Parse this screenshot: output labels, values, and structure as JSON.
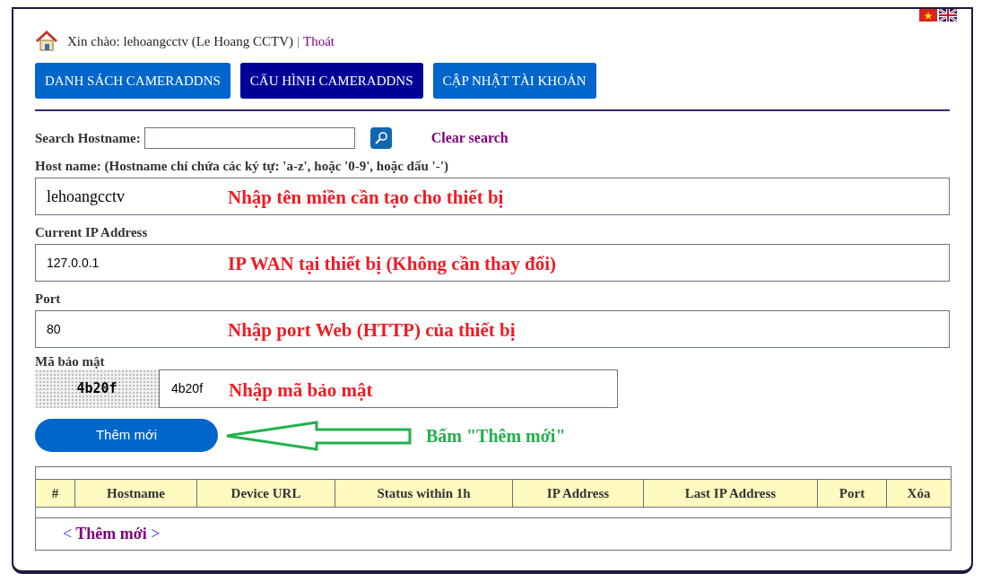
{
  "greeting": {
    "text": "Xin chào: lehoangcctv (Le Hoang CCTV)",
    "separator": "|",
    "logout": "Thoát"
  },
  "tabs": [
    {
      "label": "DANH SÁCH CAMERADDNS",
      "selected": false
    },
    {
      "label": "CẤU HÌNH CAMERADDNS",
      "selected": true
    },
    {
      "label": "CẬP NHẬT TÀI KHOẢN",
      "selected": false
    }
  ],
  "search": {
    "label": "Search Hostname:",
    "clear": "Clear search"
  },
  "fields": [
    {
      "label": "Host name: (Hostname chỉ chứa các ký tự: 'a-z', hoặc '0-9', hoặc dấu '-')",
      "value": "lehoangcctv",
      "kind": "serif",
      "annotation": "Nhập tên miền cần tạo cho thiết bị"
    },
    {
      "label": "Current IP Address",
      "value": "127.0.0.1",
      "kind": "sans",
      "annotation": "IP WAN tại thiết bị (Không cần thay đổi)"
    },
    {
      "label": "Port",
      "value": "80",
      "kind": "sans",
      "annotation": "Nhập port Web (HTTP) của thiết bị"
    }
  ],
  "captcha": {
    "label": "Mã bảo mật",
    "image_text": "4b20f",
    "value": "4b20f",
    "annotation": "Nhập mã bảo mật"
  },
  "submit": {
    "label": "Thêm mới",
    "annotation": "Bấm \"Thêm mới\""
  },
  "table": {
    "columns": [
      "#",
      "Hostname",
      "Device URL",
      "Status within 1h",
      "IP Address",
      "Last IP Address",
      "Port",
      "Xóa"
    ],
    "add_link": {
      "prefix": "<",
      "label": "Thêm mới",
      "suffix": ">"
    }
  }
}
